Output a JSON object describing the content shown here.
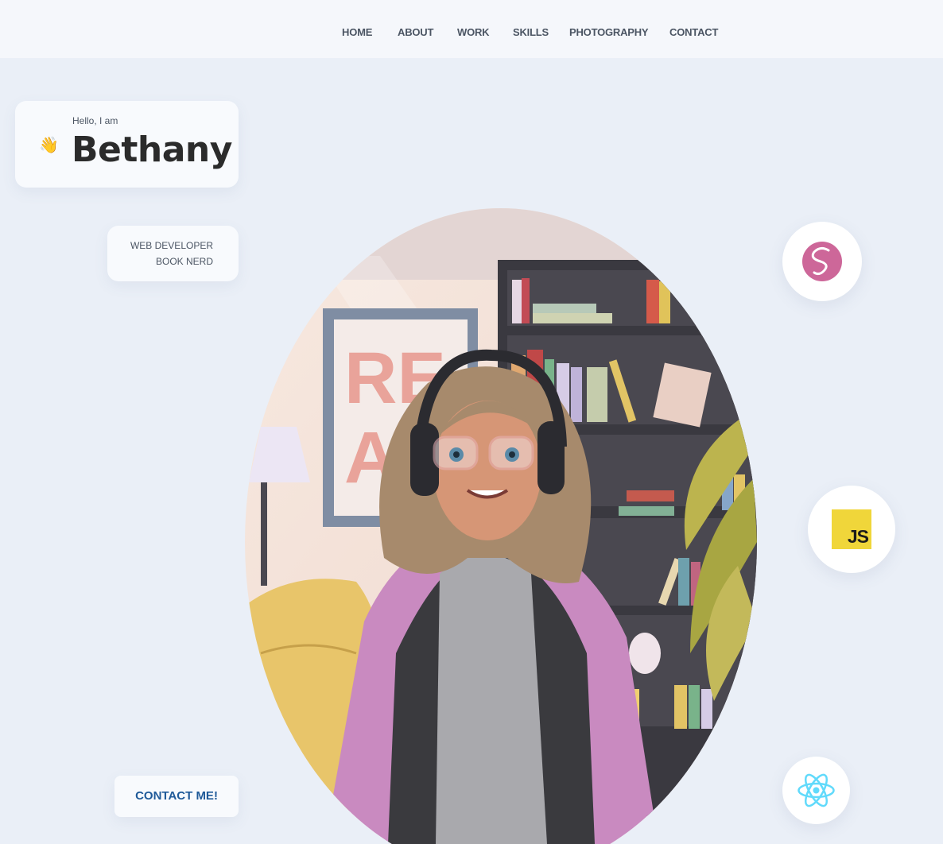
{
  "nav": {
    "items": [
      {
        "label": "HOME"
      },
      {
        "label": "ABOUT"
      },
      {
        "label": "WORK"
      },
      {
        "label": "SKILLS"
      },
      {
        "label": "PHOTOGRAPHY"
      },
      {
        "label": "CONTACT"
      }
    ]
  },
  "intro": {
    "greeting": "Hello, I am",
    "name": "Bethany",
    "wave_icon": "👋"
  },
  "roles": [
    "WEB DEVELOPER",
    "BOOK NERD"
  ],
  "contact_button": {
    "label": "CONTACT ME!"
  },
  "portrait": {
    "poster_text_line1": "RE",
    "poster_text_line2": "A"
  },
  "skills": {
    "sass_icon": "sass-logo-icon",
    "js_icon": "javascript-logo-icon",
    "js_label": "JS",
    "react_icon": "react-logo-icon"
  },
  "colors": {
    "background": "#eaeff7",
    "header": "#f5f7fb",
    "nav_text": "#4b5563",
    "contact_text": "#1f5a99",
    "sass_pink": "#cd6799",
    "js_yellow": "#f0d63a",
    "react_cyan": "#61dafb"
  }
}
